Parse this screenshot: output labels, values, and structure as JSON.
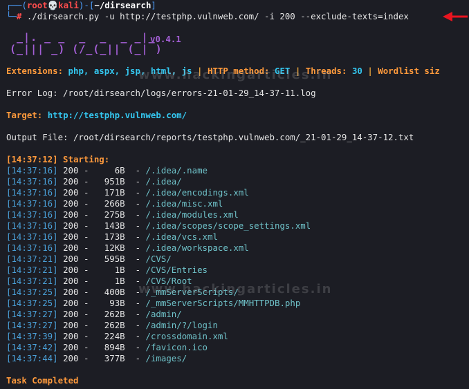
{
  "prompt": {
    "corner_top": "┌──(",
    "user": "root",
    "skull": "💀",
    "host": "kali",
    "mid": ")-[",
    "dir": "~/dirsearch",
    "close": "]",
    "corner_bottom": "└─",
    "hash": "#",
    "command": " ./dirsearch.py -u http://testphp.vulnweb.com/ -i 200 --exclude-texts=index"
  },
  "banner": {
    "art_line1": " _|. _ _  _  _  _ _|_",
    "art_line2": "(_||| _) (/_(_|| (_| )",
    "version": "v0.4.1"
  },
  "config": {
    "extensions_label": "Extensions:",
    "extensions_value": "php, aspx, jsp, html, js",
    "sep": "|",
    "method_label": "HTTP method:",
    "method_value": "GET",
    "threads_label": "Threads:",
    "threads_value": "30",
    "wordlist_label": "Wordlist siz"
  },
  "error_log": "Error Log: /root/dirsearch/logs/errors-21-01-29_14-37-11.log",
  "target": {
    "label": "Target:",
    "url": "http://testphp.vulnweb.com/"
  },
  "output_file": "Output File: /root/dirsearch/reports/testphp.vulnweb.com/_21-01-29_14-37-12.txt",
  "starting": "[14:37:12] Starting:",
  "results": [
    {
      "time": "[14:37:16]",
      "status": "200",
      "dash": "-",
      "size": "  6B",
      "path": "/.idea/.name"
    },
    {
      "time": "[14:37:16]",
      "status": "200",
      "dash": "-",
      "size": "951B",
      "path": "/.idea/"
    },
    {
      "time": "[14:37:16]",
      "status": "200",
      "dash": "-",
      "size": "171B",
      "path": "/.idea/encodings.xml"
    },
    {
      "time": "[14:37:16]",
      "status": "200",
      "dash": "-",
      "size": "266B",
      "path": "/.idea/misc.xml"
    },
    {
      "time": "[14:37:16]",
      "status": "200",
      "dash": "-",
      "size": "275B",
      "path": "/.idea/modules.xml"
    },
    {
      "time": "[14:37:16]",
      "status": "200",
      "dash": "-",
      "size": "143B",
      "path": "/.idea/scopes/scope_settings.xml"
    },
    {
      "time": "[14:37:16]",
      "status": "200",
      "dash": "-",
      "size": "173B",
      "path": "/.idea/vcs.xml"
    },
    {
      "time": "[14:37:16]",
      "status": "200",
      "dash": "-",
      "size": "12KB",
      "path": "/.idea/workspace.xml"
    },
    {
      "time": "[14:37:21]",
      "status": "200",
      "dash": "-",
      "size": "595B",
      "path": "/CVS/"
    },
    {
      "time": "[14:37:21]",
      "status": "200",
      "dash": "-",
      "size": "  1B",
      "path": "/CVS/Entries"
    },
    {
      "time": "[14:37:21]",
      "status": "200",
      "dash": "-",
      "size": "  1B",
      "path": "/CVS/Root"
    },
    {
      "time": "[14:37:25]",
      "status": "200",
      "dash": "-",
      "size": "400B",
      "path": "/_mmServerScripts/"
    },
    {
      "time": "[14:37:25]",
      "status": "200",
      "dash": "-",
      "size": " 93B",
      "path": "/_mmServerScripts/MMHTTPDB.php"
    },
    {
      "time": "[14:37:27]",
      "status": "200",
      "dash": "-",
      "size": "262B",
      "path": "/admin/"
    },
    {
      "time": "[14:37:27]",
      "status": "200",
      "dash": "-",
      "size": "262B",
      "path": "/admin/?/login"
    },
    {
      "time": "[14:37:39]",
      "status": "200",
      "dash": "-",
      "size": "224B",
      "path": "/crossdomain.xml"
    },
    {
      "time": "[14:37:42]",
      "status": "200",
      "dash": "-",
      "size": "894B",
      "path": "/favicon.ico"
    },
    {
      "time": "[14:37:44]",
      "status": "200",
      "dash": "-",
      "size": "377B",
      "path": "/images/"
    }
  ],
  "task_completed": "Task Completed",
  "watermark": "www.hackingarticles.in",
  "colors": {
    "background": "#1c1d24",
    "prompt_blue": "#4da0ff",
    "prompt_red": "#ff4d4d",
    "accent_orange": "#ff9a3c",
    "accent_cyan": "#34c7f0",
    "banner_purple": "#a45fd6",
    "arrow_red": "#e8141f"
  }
}
